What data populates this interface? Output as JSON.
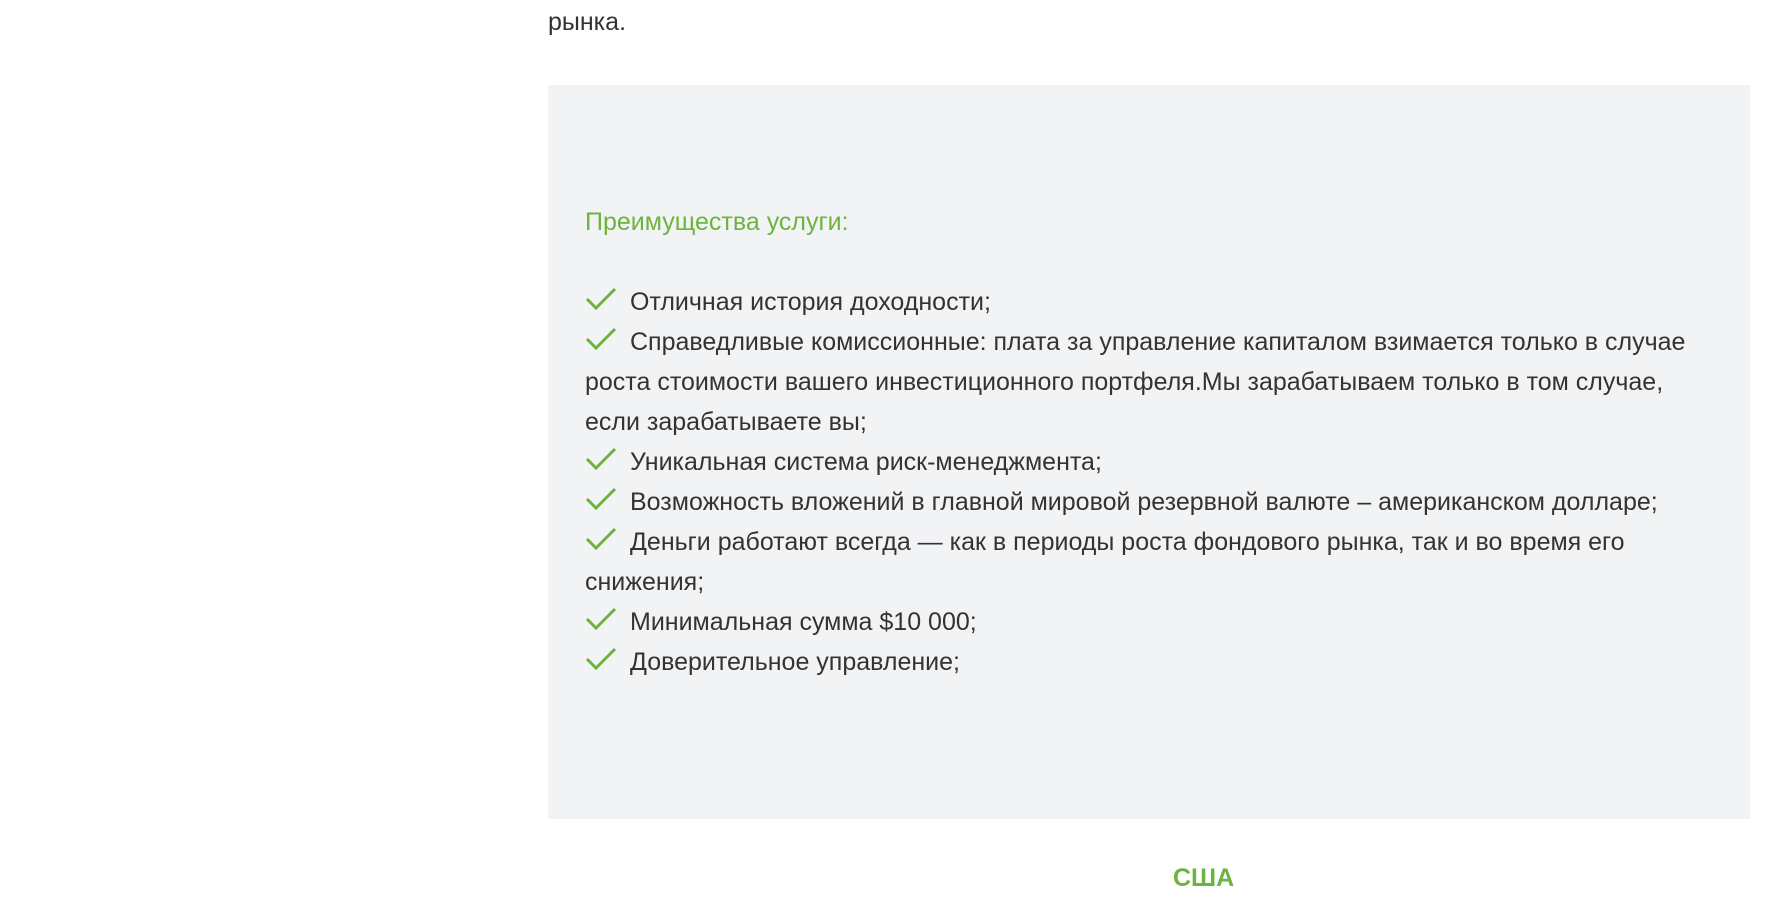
{
  "intro": {
    "tail_text": "рынка."
  },
  "benefits_panel": {
    "title": "Преимущества услуги:",
    "check_color": "#6db33f",
    "items": [
      {
        "icon": "check-icon",
        "text": "Отличная история доходности;"
      },
      {
        "icon": "check-icon",
        "text": "Справедливые комиссионные: плата за управление капиталом взимается только в случае роста стоимости вашего инвестиционного портфеля.Мы зарабатываем только в том случае, если зарабатываете вы;"
      },
      {
        "icon": "check-icon",
        "text": "Уникальная система риск-менеджмента;"
      },
      {
        "icon": "check-icon",
        "text": "Возможность вложений в главной мировой резервной валюте – американском долларе;"
      },
      {
        "icon": "check-icon",
        "text": "Деньги работают всегда — как в периоды роста фондового рынка, так и во время его снижения;"
      },
      {
        "icon": "check-icon",
        "text": "Минимальная сумма $10 000;"
      },
      {
        "icon": "check-icon",
        "text": "Доверительное управление;"
      }
    ]
  },
  "next_section": {
    "heading_partial": "США"
  },
  "colors": {
    "accent": "#6db33f",
    "panel_bg": "#f2f3f4",
    "text": "#333333"
  }
}
